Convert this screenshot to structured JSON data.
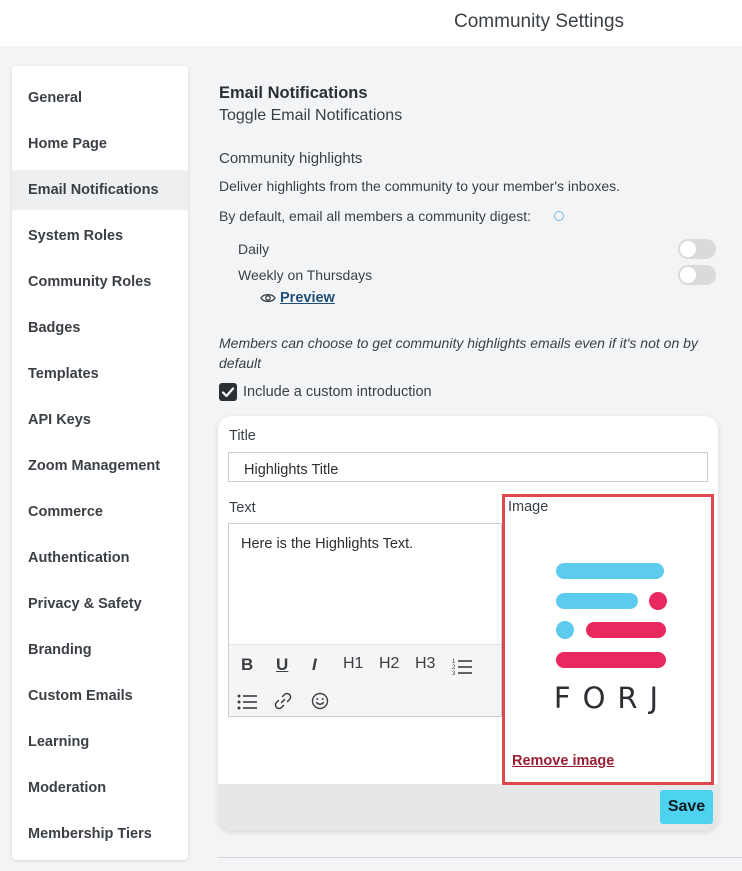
{
  "header": {
    "title": "Community Settings"
  },
  "sidebar": {
    "items": [
      {
        "label": "General"
      },
      {
        "label": "Home Page"
      },
      {
        "label": "Email Notifications",
        "active": true
      },
      {
        "label": "System Roles"
      },
      {
        "label": "Community Roles"
      },
      {
        "label": "Badges"
      },
      {
        "label": "Templates"
      },
      {
        "label": "API Keys"
      },
      {
        "label": "Zoom Management"
      },
      {
        "label": "Commerce"
      },
      {
        "label": "Authentication"
      },
      {
        "label": "Privacy & Safety"
      },
      {
        "label": "Branding"
      },
      {
        "label": "Custom Emails"
      },
      {
        "label": "Learning"
      },
      {
        "label": "Moderation"
      },
      {
        "label": "Membership Tiers"
      }
    ]
  },
  "main": {
    "section_title": "Email Notifications",
    "section_subtitle": "Toggle Email Notifications",
    "highlights_heading": "Community highlights",
    "highlights_desc": "Deliver highlights from the community to your member's inboxes.",
    "digest_label": "By default, email all members a community digest:",
    "options": [
      {
        "label": "Daily",
        "enabled": false
      },
      {
        "label": "Weekly on Thursdays",
        "enabled": false
      }
    ],
    "preview_label": "Preview",
    "note": "Members can choose to get community highlights emails even if it's not on by default",
    "custom_intro": {
      "label": "Include a custom introduction",
      "checked": true
    },
    "form": {
      "title_label": "Title",
      "title_value": "Highlights Title",
      "text_label": "Text",
      "text_value": "Here is the Highlights Text.",
      "toolbar": {
        "h1": "H1",
        "h2": "H2",
        "h3": "H3"
      },
      "image_label": "Image",
      "logo_text": "FORJ",
      "remove_image_label": "Remove image",
      "save_label": "Save"
    }
  },
  "colors": {
    "accent": "#4dd2ef",
    "highlight_border": "#e0474c",
    "logo_blue": "#5ccbee",
    "logo_pink": "#e8285e",
    "remove_link": "#9a1f35"
  }
}
